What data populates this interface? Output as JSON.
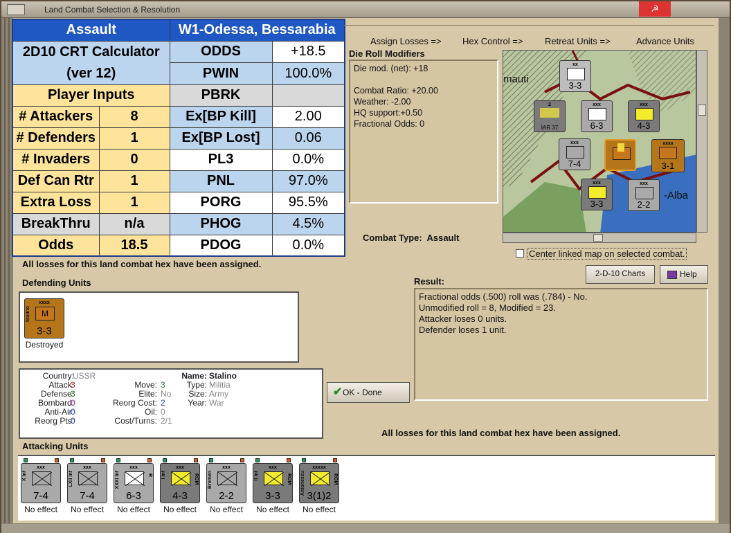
{
  "window": {
    "title": "Land Combat Selection & Resolution"
  },
  "crt": {
    "header_left": "Assault",
    "header_right": "W1-Odessa, Bessarabia",
    "calc_title": "2D10 CRT Calculator",
    "calc_version": "(ver 12)",
    "player_inputs": "Player Inputs",
    "inputs": [
      {
        "label": "# Attackers",
        "value": "8"
      },
      {
        "label": "# Defenders",
        "value": "1"
      },
      {
        "label": "# Invaders",
        "value": "0"
      },
      {
        "label": "Def Can Rtr",
        "value": "1"
      },
      {
        "label": "Extra Loss",
        "value": "1"
      },
      {
        "label": "BreakThru",
        "value": "n/a"
      },
      {
        "label": "Odds",
        "value": "18.5"
      }
    ],
    "outputs": [
      {
        "label": "ODDS",
        "value": "+18.5"
      },
      {
        "label": "PWIN",
        "value": "100.0%"
      },
      {
        "label": "PBRK",
        "value": ""
      },
      {
        "label": "Ex[BP Kill]",
        "value": "2.00"
      },
      {
        "label": "Ex[BP Lost]",
        "value": "0.06"
      },
      {
        "label": "PL3",
        "value": "0.0%"
      },
      {
        "label": "PNL",
        "value": "97.0%"
      },
      {
        "label": "PORG",
        "value": "95.5%"
      },
      {
        "label": "PHOG",
        "value": "4.5%"
      },
      {
        "label": "PDOG",
        "value": "0.0%"
      }
    ]
  },
  "phases": [
    "Assign Losses =>",
    "Hex Control =>",
    "Retreat Units =>",
    "Advance Units"
  ],
  "die_roll": {
    "title": "Die Roll Modifiers",
    "lines": [
      "Die mod. (net): +18",
      "",
      "Combat Ratio: +20.00",
      "Weather: -2.00",
      "HQ support:+0.50",
      "Fractional Odds: 0"
    ]
  },
  "map": {
    "labels": [
      "mauti",
      "-Alba"
    ],
    "counters": [
      {
        "size": "xx",
        "str": "3-3"
      },
      {
        "size": "2",
        "str": "IAR 37"
      },
      {
        "size": "xxx",
        "str": "6-3"
      },
      {
        "size": "xxx",
        "str": "4-3"
      },
      {
        "size": "xxx",
        "str": "7-4"
      },
      {
        "size": "xxxx",
        "str": "3-1"
      },
      {
        "size": "xxx",
        "str": "3-3"
      },
      {
        "size": "xxx",
        "str": "2-2"
      }
    ]
  },
  "combat_type": {
    "label": "Combat Type:",
    "value": "Assault"
  },
  "center_map": "Center linked map on selected combat.",
  "losses_msg": "All losses for this land combat hex have been assigned.",
  "buttons": {
    "charts": "2-D-10 Charts",
    "help": "Help",
    "ok": "OK - Done"
  },
  "defending": {
    "title": "Defending Units",
    "units": [
      {
        "side": "Stalino",
        "size": "xxxx",
        "sym": "M",
        "str": "3-3",
        "status": "Destroyed",
        "color": "#b5761a"
      }
    ]
  },
  "result": {
    "title": "Result:",
    "lines": [
      "Fractional odds (.500) roll was (.784)  - No.",
      "Unmodified roll = 8, Modified = 23.",
      "Attacker loses 0 units.",
      "Defender loses 1 unit."
    ]
  },
  "unit_info": {
    "country_l": "Country:",
    "country_v": "USSR",
    "attack_l": "Attack:",
    "attack_v": "3",
    "defense_l": "Defense:",
    "defense_v": "3",
    "bombard_l": "Bombard:",
    "bombard_v": "0",
    "antiair_l": "Anti-Air:",
    "antiair_v": "0",
    "reorgpts_l": "Reorg Pts:",
    "reorgpts_v": "0",
    "move_l": "Move:",
    "move_v": "3",
    "elite_l": "Elite:",
    "elite_v": "No",
    "reorgcost_l": "Reorg Cost:",
    "reorgcost_v": "2",
    "oil_l": "Oil:",
    "oil_v": "0",
    "costturns_l": "Cost/Turns:",
    "costturns_v": "2/1",
    "name_l": "Name:",
    "name_v": "Stalino",
    "type_l": "Type:",
    "type_v": "Militia",
    "size_l": "Size:",
    "size_v": "Army",
    "year_l": "Year:",
    "year_v": "War"
  },
  "attacking": {
    "title": "Attacking Units",
    "units": [
      {
        "side": "X Inf",
        "size": "xxx",
        "str": "7-4",
        "status": "No effect",
        "color": "#a9a9a9",
        "sym": "#a9a9a9",
        "nat": ""
      },
      {
        "side": "LXII Inf",
        "size": "xxx",
        "str": "7-4",
        "status": "No effect",
        "color": "#a9a9a9",
        "sym": "#a9a9a9",
        "nat": ""
      },
      {
        "side": "XXXI Inf",
        "size": "xxx",
        "str": "6-3",
        "status": "No effect",
        "color": "#a9a9a9",
        "sym": "#ffffff",
        "nat": "R"
      },
      {
        "side": "I Inf",
        "size": "xxx",
        "str": "4-3",
        "status": "No effect",
        "color": "#7a7a7a",
        "sym": "#f2ec2b",
        "nat": "ROM"
      },
      {
        "side": "Bremen",
        "size": "xxx",
        "str": "2-2",
        "status": "No effect",
        "color": "#a9a9a9",
        "sym": "#a9a9a9",
        "nat": ""
      },
      {
        "side": "II Inf",
        "size": "xxx",
        "str": "3-3",
        "status": "No effect",
        "color": "#7a7a7a",
        "sym": "#f2ec2b",
        "nat": "ROM"
      },
      {
        "side": "Antonescu",
        "size": "xxxxx",
        "str": "3(1)2",
        "status": "No effect",
        "color": "#7a7a7a",
        "sym": "#f2ec2b",
        "nat": "ROM"
      }
    ]
  }
}
